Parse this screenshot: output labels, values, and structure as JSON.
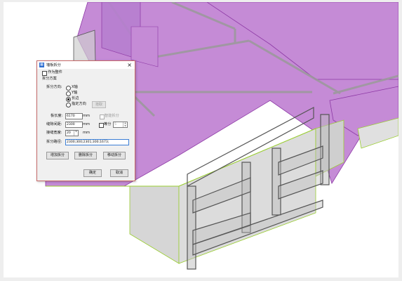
{
  "dialog": {
    "title": "墙板拆分",
    "close": "×",
    "as_component_label": "作为整件",
    "section_label": "拆分方案",
    "direction_label": "拆分方向:",
    "directions": [
      "X轴",
      "Y轴",
      "长边",
      "指定方向"
    ],
    "pick_button": "拾取",
    "selected_direction": "长边",
    "panel_width_label": "板长度:",
    "panel_width_value": "6170",
    "unit": "mm",
    "smart_split_label": "智能拆分",
    "seam_width_label": "缝隙间距:",
    "seam_width_value": "2300",
    "equal_label": "等分",
    "equal_value": "5",
    "gap_label": "接缝宽度:",
    "gap_value": "20",
    "split_path_label": "拆分路径:",
    "split_path_value": "2300;300;2301;300;1673;",
    "add_button": "增加拆分",
    "delete_button": "删除拆分",
    "move_button": "移动拆分",
    "ok_button": "确定",
    "cancel_button": "取消"
  },
  "colors": {
    "slab": "#c58bd6",
    "slab_edge": "#8e3aa6",
    "wall": "#d9d9d9",
    "wall_edge": "#9acd32",
    "dialog_border": "#c76a6a"
  }
}
